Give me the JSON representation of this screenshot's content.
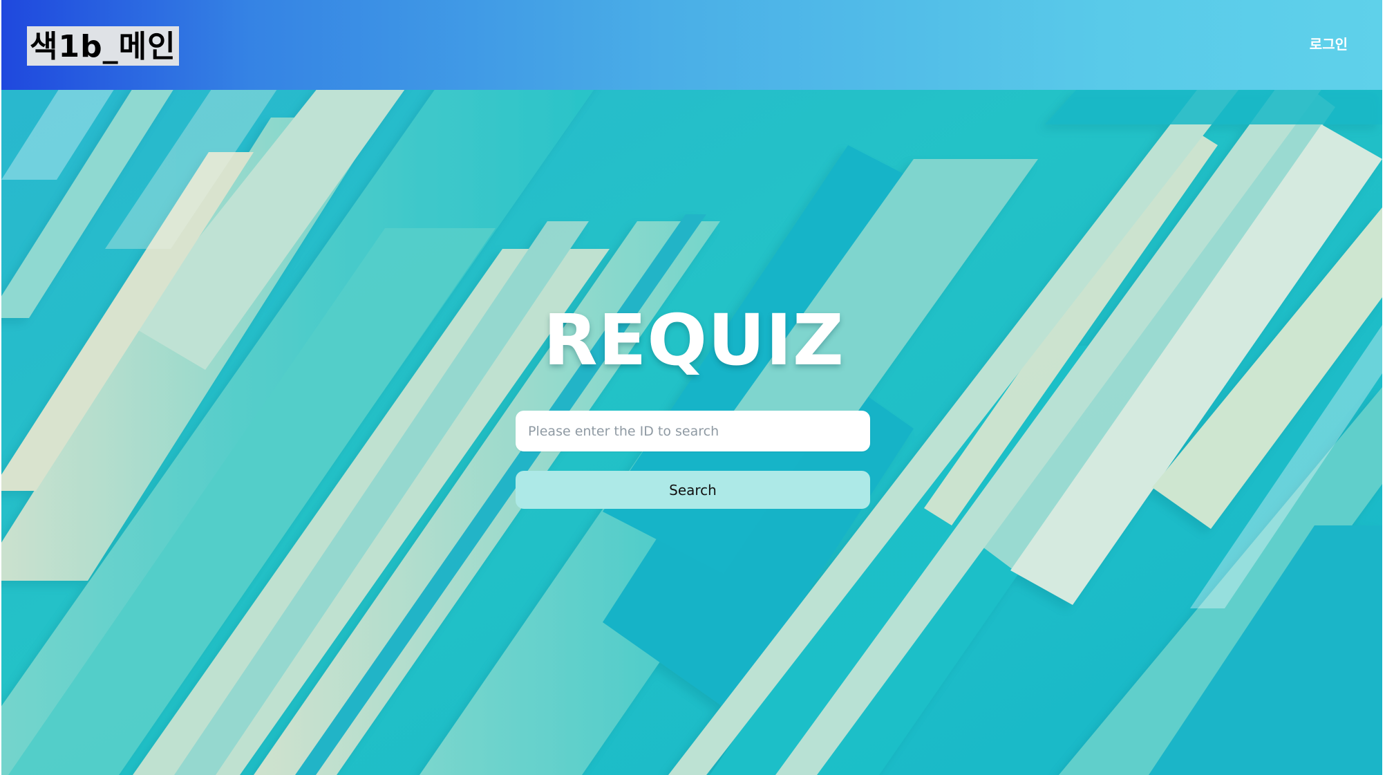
{
  "header": {
    "logo_text": "색1b_메인",
    "login_label": "로그인"
  },
  "hero": {
    "title": "REQUIZ",
    "search": {
      "placeholder": "Please enter the ID to search",
      "value": "",
      "button_label": "Search"
    }
  },
  "theme": {
    "header_gradient": [
      "#1f48de",
      "#3583e4",
      "#4aaee7",
      "#59cae9",
      "#5fd1ea"
    ],
    "background": "#1fc1c9",
    "search_button": "#ade9e7",
    "input_background": "#ffffff",
    "title_color": "#ffffff"
  }
}
